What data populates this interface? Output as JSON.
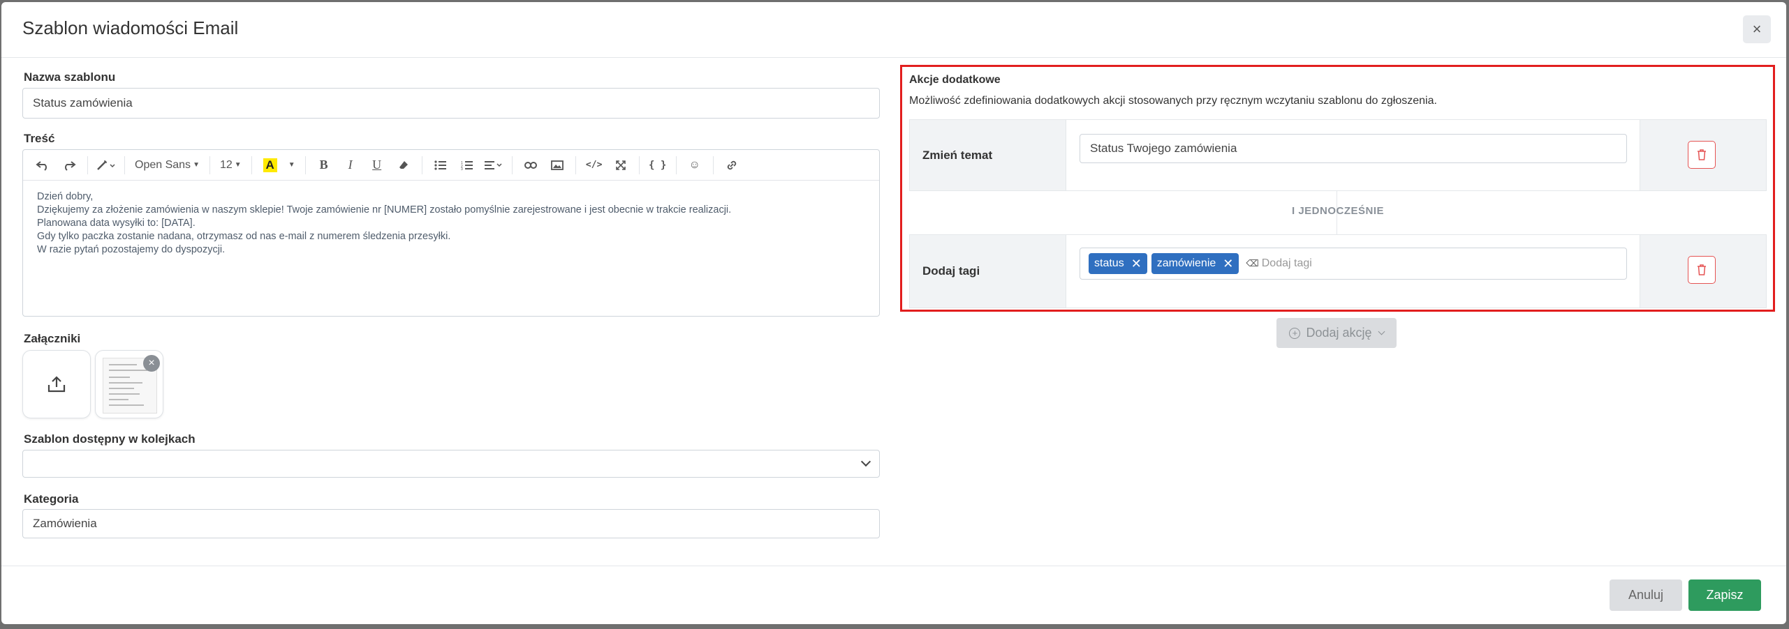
{
  "modal": {
    "title": "Szablon wiadomości Email",
    "close_label": "×"
  },
  "form": {
    "template_name_label": "Nazwa szablonu",
    "template_name_value": "Status zamówienia",
    "content_label": "Treść",
    "toolbar": {
      "font_family": "Open Sans",
      "font_size": "12",
      "icons": [
        "undo-icon",
        "redo-icon",
        "magic-wand-icon",
        "font-color-icon",
        "bold-icon",
        "italic-icon",
        "underline-icon",
        "eraser-icon",
        "bullet-list-icon",
        "numbered-list-icon",
        "align-icon",
        "link-icon",
        "image-icon",
        "code-view-icon",
        "fullscreen-icon",
        "braces-icon",
        "emoji-icon",
        "link-alt-icon"
      ]
    },
    "content_lines": [
      "Dzień dobry,",
      "Dziękujemy za złożenie zamówienia w naszym sklepie! Twoje zamówienie nr [NUMER] zostało pomyślnie zarejestrowane i jest obecnie w trakcie realizacji.",
      "Planowana data wysyłki to: [DATA].",
      "Gdy tylko paczka zostanie nadana, otrzymasz od nas e-mail z numerem śledzenia przesyłki.",
      "W razie pytań pozostajemy do dyspozycji."
    ],
    "attachments_label": "Załączniki",
    "queues_label": "Szablon dostępny w kolejkach",
    "queues_value": "",
    "category_label": "Kategoria",
    "category_value": "Zamówienia"
  },
  "actions": {
    "title": "Akcje dodatkowe",
    "description": "Możliwość zdefiniowania dodatkowych akcji stosowanych przy ręcznym wczytaniu szablonu do zgłoszenia.",
    "change_subject_label": "Zmień temat",
    "change_subject_value": "Status Twojego zamówienia",
    "connector_label": "I JEDNOCZEŚNIE",
    "add_tags_label": "Dodaj tagi",
    "tags": [
      "status",
      "zamówienie"
    ],
    "tags_placeholder": "Dodaj tagi",
    "add_action_label": "Dodaj akcję"
  },
  "footer": {
    "cancel_label": "Anuluj",
    "save_label": "Zapisz"
  },
  "colors": {
    "accent": "#2f6fc0",
    "save": "#2e9b5e",
    "danger": "#e55353",
    "highlight": "#e21e1e"
  }
}
